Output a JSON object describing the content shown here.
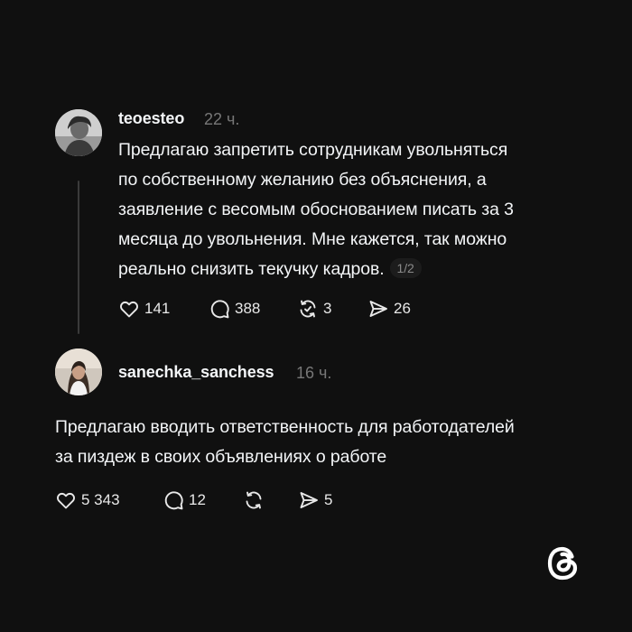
{
  "posts": [
    {
      "username": "teoesteo",
      "time": "22 ч.",
      "text_lines": [
        "Предлагаю запретить сотрудникам увольняться",
        "по собственному желанию без объяснения, а",
        "заявление с весомым обоснованием писать за 3",
        "месяца до увольнения. Мне кажется, так можно",
        "реально снизить текучку кадров."
      ],
      "page_counter": "1/2",
      "likes": "141",
      "replies": "388",
      "reposts": "3",
      "shares": "26"
    },
    {
      "username": "sanechka_sanchess",
      "time": "16 ч.",
      "text_lines": [
        "Предлагаю вводить ответственность для работодателей",
        "за пиздеж в своих объявлениях о работе"
      ],
      "likes": "5 343",
      "replies": "12",
      "reposts": "",
      "shares": "5"
    }
  ],
  "icons": {
    "like": "heart-icon",
    "reply": "comment-icon",
    "repost": "repost-icon",
    "share": "send-icon",
    "brand": "threads-logo-icon"
  },
  "colors": {
    "background": "#101010",
    "text": "#f3f5f7",
    "muted": "#777777"
  }
}
